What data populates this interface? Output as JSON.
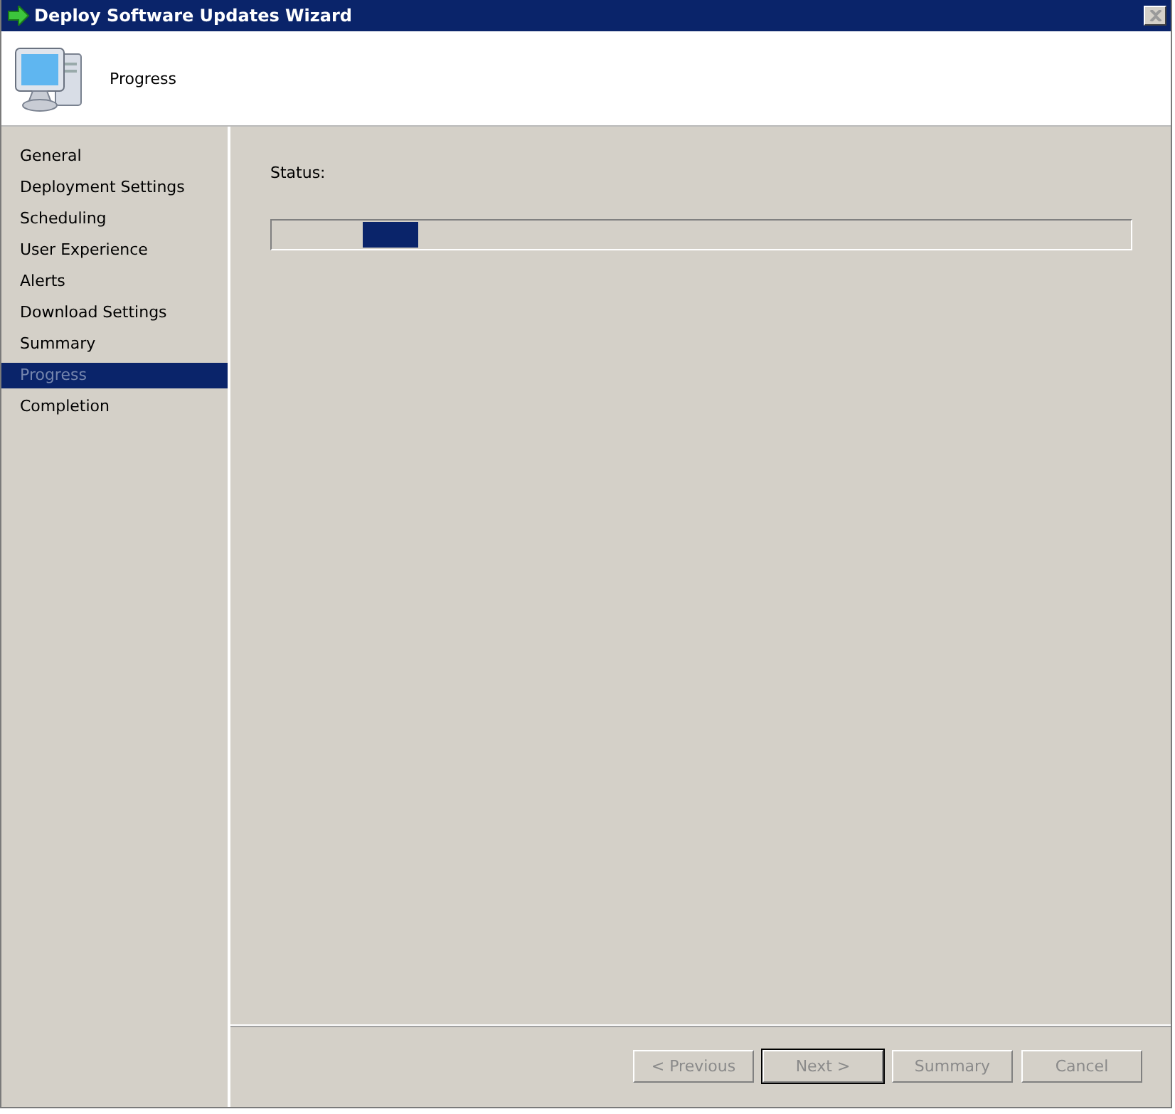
{
  "window": {
    "title": "Deploy Software Updates Wizard",
    "close_disabled": true
  },
  "header": {
    "title": "Progress"
  },
  "steps": [
    {
      "label": "General",
      "selected": false
    },
    {
      "label": "Deployment Settings",
      "selected": false
    },
    {
      "label": "Scheduling",
      "selected": false
    },
    {
      "label": "User Experience",
      "selected": false
    },
    {
      "label": "Alerts",
      "selected": false
    },
    {
      "label": "Download Settings",
      "selected": false
    },
    {
      "label": "Summary",
      "selected": false
    },
    {
      "label": "Progress",
      "selected": true
    },
    {
      "label": "Completion",
      "selected": false
    }
  ],
  "status_label": "Status:",
  "progress": {
    "marquee": true,
    "level": 0.17
  },
  "buttons": [
    {
      "label": "< Previous",
      "disabled": true,
      "default": false
    },
    {
      "label": "Next >",
      "disabled": true,
      "default": true
    },
    {
      "label": "Summary",
      "disabled": true,
      "default": false
    },
    {
      "label": "Cancel",
      "disabled": true,
      "default": false
    }
  ]
}
